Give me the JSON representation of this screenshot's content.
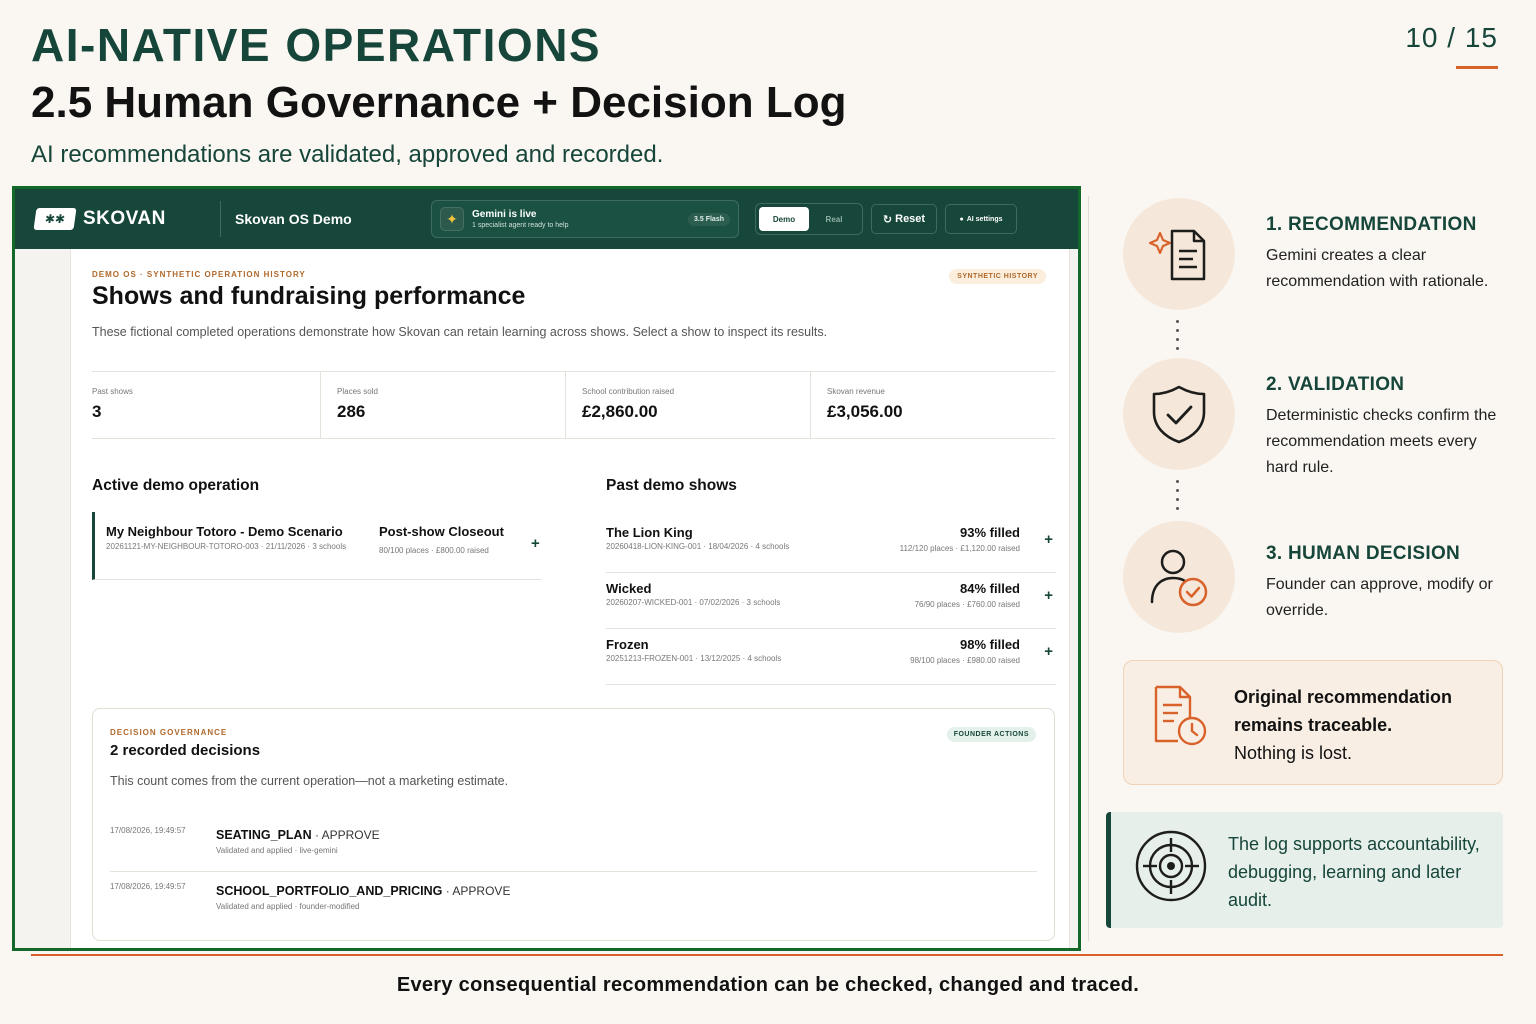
{
  "slide": {
    "kicker": "AI-NATIVE OPERATIONS",
    "title": "2.5 Human Governance + Decision Log",
    "subtitle": "AI recommendations are validated, approved and recorded.",
    "page_number": "10 / 15",
    "footer": "Every consequential recommendation can be checked, changed and traced."
  },
  "app": {
    "logo_text": "SKOVAN",
    "app_name": "Skovan OS Demo",
    "gemini": {
      "title": "Gemini is live",
      "subtitle": "1 specialist agent ready to help",
      "badge": "3.5 Flash"
    },
    "mode": {
      "active": "Demo",
      "inactive": "Real"
    },
    "reset_label": "Reset",
    "ai_settings_label": "AI settings",
    "section": {
      "eyebrow": "DEMO OS · SYNTHETIC OPERATION HISTORY",
      "badge": "SYNTHETIC HISTORY",
      "title": "Shows and fundraising performance",
      "description": "These fictional completed operations demonstrate how Skovan can retain learning across shows. Select a show to inspect its results."
    },
    "stats": [
      {
        "label": "Past shows",
        "value": "3"
      },
      {
        "label": "Places sold",
        "value": "286"
      },
      {
        "label": "School contribution raised",
        "value": "£2,860.00"
      },
      {
        "label": "Skovan revenue",
        "value": "£3,056.00"
      }
    ],
    "active_op": {
      "heading": "Active demo operation",
      "name": "My Neighbour Totoro - Demo Scenario",
      "meta": "20261121-MY-NEIGHBOUR-TOTORO-003 · 21/11/2026 · 3 schools",
      "status": "Post-show Closeout",
      "status_meta": "80/100 places · £800.00 raised"
    },
    "past": {
      "heading": "Past demo shows",
      "rows": [
        {
          "name": "The Lion King",
          "meta": "20260418-LION-KING-001 · 18/04/2026 · 4 schools",
          "fill": "93% filled",
          "places": "112/120 places · £1,120.00 raised"
        },
        {
          "name": "Wicked",
          "meta": "20260207-WICKED-001 · 07/02/2026 · 3 schools",
          "fill": "84% filled",
          "places": "76/90 places · £760.00 raised"
        },
        {
          "name": "Frozen",
          "meta": "20251213-FROZEN-001 · 13/12/2025 · 4 schools",
          "fill": "98% filled",
          "places": "98/100 places · £980.00 raised"
        }
      ]
    },
    "governance": {
      "eyebrow": "DECISION GOVERNANCE",
      "badge": "FOUNDER ACTIONS",
      "title": "2 recorded decisions",
      "description": "This count comes from the current operation—not a marketing estimate.",
      "decisions": [
        {
          "time": "17/08/2026, 19:49:57",
          "key": "SEATING_PLAN",
          "action": " · APPROVE",
          "meta": "Validated and applied · live-gemini"
        },
        {
          "time": "17/08/2026, 19:49:57",
          "key": "SCHOOL_PORTFOLIO_AND_PRICING",
          "action": " · APPROVE",
          "meta": "Validated and applied · founder-modified"
        }
      ]
    }
  },
  "steps": [
    {
      "title": "1. RECOMMENDATION",
      "body": "Gemini creates a clear recommendation with rationale.",
      "icon": "document-sparkle-icon"
    },
    {
      "title": "2. VALIDATION",
      "body": "Deterministic checks confirm the recommendation meets every hard rule.",
      "icon": "shield-check-icon"
    },
    {
      "title": "3. HUMAN DECISION",
      "body": "Founder can approve, modify or override.",
      "icon": "user-check-icon"
    }
  ],
  "trace_card": {
    "strong": "Original recommendation remains traceable.",
    "normal": "Nothing is lost."
  },
  "log_card": {
    "text": "The log supports accountability, debugging, learning and later audit."
  },
  "colors": {
    "brand_green": "#16453a",
    "accent_orange": "#d9622b",
    "frame_green": "#14682a"
  }
}
